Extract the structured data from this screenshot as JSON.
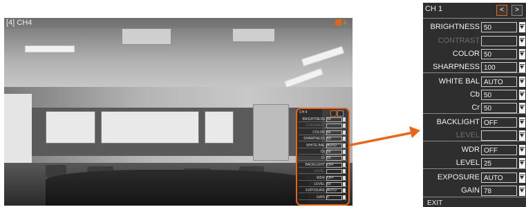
{
  "camera": {
    "title": "[4] CH4"
  },
  "mini_menu": {
    "title": "CH 4",
    "rows": [
      {
        "label": "BRIGHTNESS",
        "value": "50"
      },
      {
        "label": "CONTRAST",
        "value": ""
      },
      {
        "label": "COLOR",
        "value": "50"
      },
      {
        "label": "SHARPNESS",
        "value": "50"
      },
      {
        "label": "WHITE BAL",
        "value": "AUTO"
      },
      {
        "label": "Cb",
        "value": "50"
      },
      {
        "label": "Cr",
        "value": "50"
      },
      {
        "label": "BACKLIGHT",
        "value": "OFF"
      },
      {
        "label": "LEVEL",
        "value": ""
      },
      {
        "label": "WDR",
        "value": "OFF"
      },
      {
        "label": "LEVEL",
        "value": "50"
      },
      {
        "label": "EXPOSURE",
        "value": "AUTO"
      },
      {
        "label": "GAIN",
        "value": "0"
      }
    ]
  },
  "menu": {
    "title": "CH 1",
    "prev_label": "<",
    "next_label": ">",
    "rows": [
      {
        "label": "BRIGHTNESS",
        "value": "50",
        "enabled": true
      },
      {
        "label": "CONTRAST",
        "value": "",
        "enabled": false
      },
      {
        "label": "COLOR",
        "value": "50",
        "enabled": true
      },
      {
        "label": "SHARPNESS",
        "value": "100",
        "enabled": true
      },
      {
        "label": "WHITE BAL",
        "value": "AUTO",
        "enabled": true
      },
      {
        "label": "Cb",
        "value": "50",
        "enabled": true
      },
      {
        "label": "Cr",
        "value": "50",
        "enabled": true
      },
      {
        "label": "BACKLIGHT",
        "value": "OFF",
        "enabled": true
      },
      {
        "label": "LEVEL",
        "value": "",
        "enabled": false
      },
      {
        "label": "WDR",
        "value": "OFF",
        "enabled": true
      },
      {
        "label": "LEVEL",
        "value": "25",
        "enabled": true
      },
      {
        "label": "EXPOSURE",
        "value": "AUTO",
        "enabled": true
      },
      {
        "label": "GAIN",
        "value": "78",
        "enabled": true
      }
    ],
    "exit_label": "EXIT"
  },
  "colors": {
    "accent": "#e8651a",
    "panel_bg": "#2e2e2e"
  }
}
